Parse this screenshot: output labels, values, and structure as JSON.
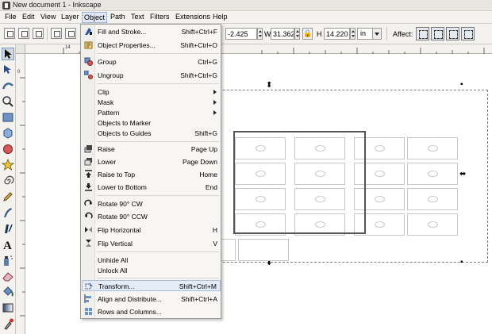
{
  "window": {
    "title": "New document 1 - Inkscape"
  },
  "menubar": {
    "items": [
      "File",
      "Edit",
      "View",
      "Layer",
      "Object",
      "Path",
      "Text",
      "Filters",
      "Extensions",
      "Help"
    ],
    "active": "Object"
  },
  "toolbar": {
    "x_value": "-2.425",
    "w_label": "W",
    "w_value": "31.362",
    "h_label": "H",
    "h_value": "14.220",
    "unit": "in",
    "affect_label": "Affect:"
  },
  "ruler": {
    "labels": [
      "14",
      "0"
    ]
  },
  "object_menu": {
    "items": [
      {
        "label": "Fill and Stroke...",
        "shortcut": "Shift+Ctrl+F",
        "icon": "fill-stroke-icon"
      },
      {
        "label": "Object Properties...",
        "shortcut": "Shift+Ctrl+O",
        "icon": "object-properties-icon"
      },
      {
        "label": "Group",
        "shortcut": "Ctrl+G",
        "icon": "group-icon"
      },
      {
        "label": "Ungroup",
        "shortcut": "Shift+Ctrl+G",
        "icon": "ungroup-icon"
      },
      {
        "label": "Clip",
        "shortcut": "",
        "submenu": true
      },
      {
        "label": "Mask",
        "shortcut": "",
        "submenu": true
      },
      {
        "label": "Pattern",
        "shortcut": "",
        "submenu": true
      },
      {
        "label": "Objects to Marker",
        "shortcut": ""
      },
      {
        "label": "Objects to Guides",
        "shortcut": "Shift+G"
      },
      {
        "label": "Raise",
        "shortcut": "Page Up",
        "icon": "raise-icon"
      },
      {
        "label": "Lower",
        "shortcut": "Page Down",
        "icon": "lower-icon"
      },
      {
        "label": "Raise to Top",
        "shortcut": "Home",
        "icon": "raise-to-top-icon"
      },
      {
        "label": "Lower to Bottom",
        "shortcut": "End",
        "icon": "lower-to-bottom-icon"
      },
      {
        "label": "Rotate 90° CW",
        "shortcut": "",
        "icon": "rotate-cw-icon"
      },
      {
        "label": "Rotate 90° CCW",
        "shortcut": "",
        "icon": "rotate-ccw-icon"
      },
      {
        "label": "Flip Horizontal",
        "shortcut": "H",
        "icon": "flip-horizontal-icon"
      },
      {
        "label": "Flip Vertical",
        "shortcut": "V",
        "icon": "flip-vertical-icon"
      },
      {
        "label": "Unhide All",
        "shortcut": ""
      },
      {
        "label": "Unlock All",
        "shortcut": ""
      },
      {
        "label": "Transform...",
        "shortcut": "Shift+Ctrl+M",
        "icon": "transform-icon",
        "highlighted": true
      },
      {
        "label": "Align and Distribute...",
        "shortcut": "Shift+Ctrl+A",
        "icon": "align-distribute-icon"
      },
      {
        "label": "Rows and Columns...",
        "shortcut": "",
        "icon": "rows-columns-icon"
      }
    ]
  },
  "colors": {
    "menu_highlight": "#e2ebf6",
    "chrome": "#f3f2ef",
    "selection_dash": "#7a7a7a"
  }
}
